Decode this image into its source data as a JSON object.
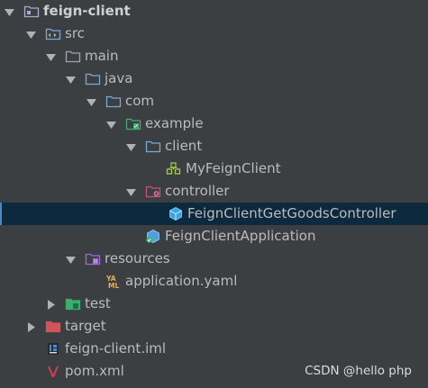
{
  "tree": [
    {
      "label": "feign-client",
      "bold": true,
      "level": 0,
      "expander": "expanded",
      "icon": "module-folder-icon",
      "selected": false
    },
    {
      "label": "src",
      "bold": false,
      "level": 1,
      "expander": "expanded",
      "icon": "source-folder-icon",
      "selected": false
    },
    {
      "label": "main",
      "bold": false,
      "level": 2,
      "expander": "expanded",
      "icon": "folder-icon",
      "selected": false
    },
    {
      "label": "java",
      "bold": false,
      "level": 3,
      "expander": "expanded",
      "icon": "source-root-folder-icon",
      "selected": false
    },
    {
      "label": "com",
      "bold": false,
      "level": 4,
      "expander": "expanded",
      "icon": "package-folder-icon",
      "selected": false
    },
    {
      "label": "example",
      "bold": false,
      "level": 5,
      "expander": "expanded",
      "icon": "spring-package-icon",
      "selected": false
    },
    {
      "label": "client",
      "bold": false,
      "level": 6,
      "expander": "expanded",
      "icon": "package-folder-icon",
      "selected": false
    },
    {
      "label": "MyFeignClient",
      "bold": false,
      "level": 7,
      "expander": "none",
      "icon": "feign-interface-icon",
      "selected": false
    },
    {
      "label": "controller",
      "bold": false,
      "level": 6,
      "expander": "expanded",
      "icon": "controller-package-icon",
      "selected": false
    },
    {
      "label": "FeignClientGetGoodsController",
      "bold": false,
      "level": 7,
      "expander": "none",
      "icon": "spring-bean-class-icon",
      "selected": true
    },
    {
      "label": "FeignClientApplication",
      "bold": false,
      "level": 6,
      "expander": "none",
      "icon": "spring-boot-app-icon",
      "selected": false
    },
    {
      "label": "resources",
      "bold": false,
      "level": 3,
      "expander": "expanded",
      "icon": "resources-folder-icon",
      "selected": false
    },
    {
      "label": "application.yaml",
      "bold": false,
      "level": 4,
      "expander": "none",
      "icon": "yaml-file-icon",
      "selected": false
    },
    {
      "label": "test",
      "bold": false,
      "level": 2,
      "expander": "collapsed",
      "icon": "test-folder-icon",
      "selected": false
    },
    {
      "label": "target",
      "bold": false,
      "level": 1,
      "expander": "collapsed",
      "icon": "excluded-folder-icon",
      "selected": false
    },
    {
      "label": "feign-client.iml",
      "bold": false,
      "level": 1,
      "expander": "none",
      "icon": "iml-file-icon",
      "selected": false
    },
    {
      "label": "pom.xml",
      "bold": false,
      "level": 1,
      "expander": "none",
      "icon": "maven-pom-icon",
      "selected": false
    }
  ],
  "watermark": "CSDN @hello php",
  "colors": {
    "background": "#3c3f41",
    "text": "#bbbbbb",
    "selection": "#0d293e",
    "selection_border": "#4a88c7",
    "arrow": "#afb1b3",
    "folder_blue": "#7ba7d6",
    "folder_grey": "#9aa7b0",
    "folder_red": "#c94c4c",
    "folder_green": "#3aaf6b",
    "folder_purple": "#9c6bd6"
  }
}
